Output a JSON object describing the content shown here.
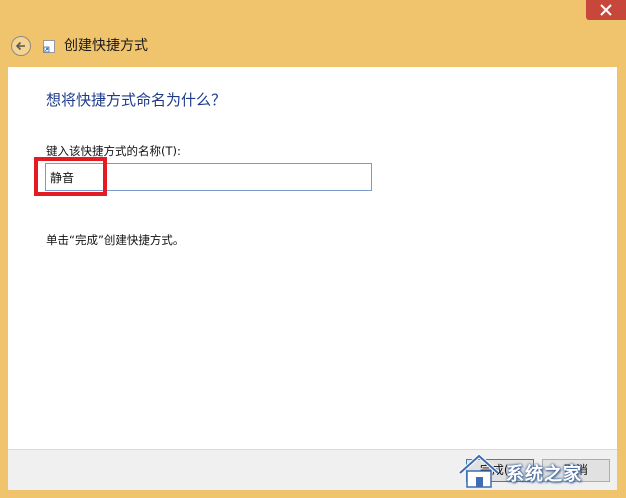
{
  "window": {
    "title": "创建快捷方式",
    "close_icon": "close-icon",
    "back_icon": "back-arrow-icon",
    "title_icon": "shortcut-icon"
  },
  "main": {
    "heading": "想将快捷方式命名为什么？",
    "field_label": "键入该快捷方式的名称(T):",
    "name_value": "静音",
    "hint": "单击“完成”创建快捷方式。"
  },
  "footer": {
    "finish_label": "完成(F)",
    "cancel_label": "取消"
  },
  "watermark": {
    "text": "系统之家"
  },
  "colors": {
    "frame": "#F0C46C",
    "heading": "#1E3B8A",
    "highlight": "#E41B23",
    "close": "#C7483B"
  }
}
